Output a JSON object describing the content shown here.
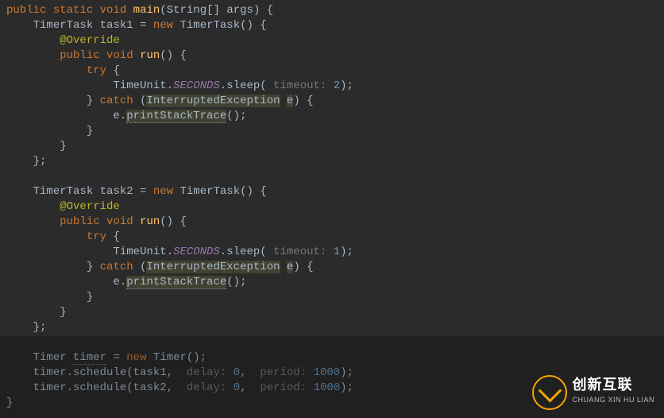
{
  "code": {
    "l1": {
      "public": "public",
      "static": "static",
      "void": "void",
      "main": "main",
      "string": "String",
      "arr": "[]",
      "args": "args"
    },
    "l2": {
      "type": "TimerTask",
      "var": "task1",
      "new": "new",
      "ctor": "TimerTask"
    },
    "l3": {
      "annotation": "@Override"
    },
    "l4": {
      "public": "public",
      "void": "void",
      "run": "run"
    },
    "l5": {
      "try": "try"
    },
    "l6": {
      "cls": "TimeUnit",
      "dot": ".",
      "field": "SECONDS",
      "dot2": ".",
      "method": "sleep",
      "hint": "timeout:",
      "val": "2"
    },
    "l7": {
      "catch": "catch",
      "exType": "InterruptedException",
      "exVar": "e"
    },
    "l8": {
      "obj": "e",
      "method": "printStackTrace"
    },
    "l12": {
      "type": "TimerTask",
      "var": "task2",
      "new": "new",
      "ctor": "TimerTask"
    },
    "l13": {
      "annotation": "@Override"
    },
    "l14": {
      "public": "public",
      "void": "void",
      "run": "run"
    },
    "l15": {
      "try": "try"
    },
    "l16": {
      "cls": "TimeUnit",
      "dot": ".",
      "field": "SECONDS",
      "dot2": ".",
      "method": "sleep",
      "hint": "timeout:",
      "val": "1"
    },
    "l17": {
      "catch": "catch",
      "exType": "InterruptedException",
      "exVar": "e"
    },
    "l18": {
      "obj": "e",
      "method": "printStackTrace"
    },
    "l22": {
      "type": "Timer",
      "var": "timer",
      "new": "new",
      "ctor": "Timer"
    },
    "l23": {
      "obj": "timer",
      "method": "schedule",
      "arg1": "task1",
      "hint1": "delay:",
      "v1": "0",
      "hint2": "period:",
      "v2": "1000"
    },
    "l24": {
      "obj": "timer",
      "method": "schedule",
      "arg1": "task2",
      "hint1": "delay:",
      "v1": "0",
      "hint2": "period:",
      "v2": "1000"
    }
  },
  "watermark": {
    "cn": "创新互联",
    "en": "CHUANG XIN HU LIAN"
  }
}
